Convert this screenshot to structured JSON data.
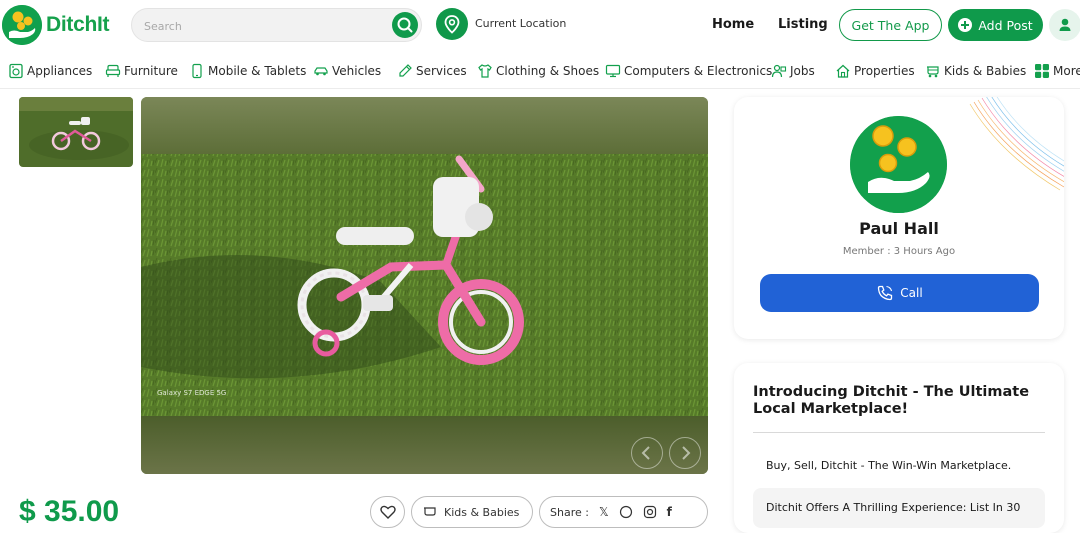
{
  "brand": {
    "name": "DitchIt",
    "accent": "#0f9a4b",
    "call_color": "#2162d6"
  },
  "header": {
    "search_placeholder": "Search",
    "location_label": "Current Location",
    "nav": {
      "home": "Home",
      "listing": "Listing"
    },
    "get_app_label": "Get The App",
    "add_post_label": "Add Post"
  },
  "categories": [
    {
      "label": "Appliances",
      "icon": "appliance-icon"
    },
    {
      "label": "Furniture",
      "icon": "furniture-icon"
    },
    {
      "label": "Mobile & Tablets",
      "icon": "mobile-icon"
    },
    {
      "label": "Vehicles",
      "icon": "car-icon"
    },
    {
      "label": "Services",
      "icon": "services-icon"
    },
    {
      "label": "Clothing & Shoes",
      "icon": "clothing-icon"
    },
    {
      "label": "Computers & Electronics",
      "icon": "computer-icon"
    },
    {
      "label": "Jobs",
      "icon": "jobs-icon"
    },
    {
      "label": "Properties",
      "icon": "property-icon"
    },
    {
      "label": "Kids & Babies",
      "icon": "stroller-icon"
    },
    {
      "label": "More",
      "icon": "grid-icon"
    }
  ],
  "listing": {
    "price": "$ 35.00",
    "image_watermark": "Galaxy S7 EDGE 5G",
    "category_pill": "Kids & Babies",
    "share_label": "Share :"
  },
  "seller": {
    "name": "Paul Hall",
    "member_since": "Member : 3 Hours Ago",
    "call_label": "Call"
  },
  "intro": {
    "title": "Introducing Ditchit - The Ultimate Local Marketplace!",
    "line1": "Buy, Sell, Ditchit - The Win-Win Marketplace.",
    "line2": "Ditchit Offers A Thrilling Experience: List In 30"
  }
}
